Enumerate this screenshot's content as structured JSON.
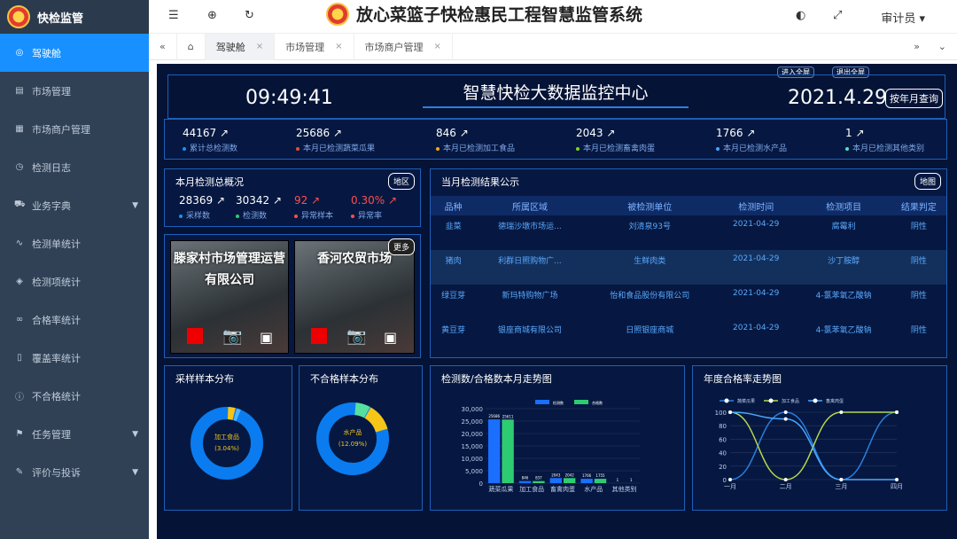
{
  "sidebar": {
    "brand": "快检监管",
    "items": [
      {
        "label": "驾驶舱",
        "icon": "dashboard-icon",
        "active": true
      },
      {
        "label": "市场管理",
        "icon": "document-icon"
      },
      {
        "label": "市场商户管理",
        "icon": "calendar-icon"
      },
      {
        "label": "检测日志",
        "icon": "clock-icon"
      },
      {
        "label": "业务字典",
        "icon": "car-icon",
        "expand": true
      },
      {
        "label": "检测单统计",
        "icon": "pulse-icon"
      },
      {
        "label": "检测项统计",
        "icon": "chat-icon"
      },
      {
        "label": "合格率统计",
        "icon": "infinity-icon"
      },
      {
        "label": "覆盖率统计",
        "icon": "file-icon"
      },
      {
        "label": "不合格统计",
        "icon": "info-icon"
      },
      {
        "label": "任务管理",
        "icon": "flag-icon",
        "expand": true
      },
      {
        "label": "评价与投诉",
        "icon": "edit-icon",
        "expand": true
      }
    ]
  },
  "header": {
    "title": "放心菜篮子快检惠民工程智慧监管系统",
    "user": "审计员"
  },
  "tabs": [
    {
      "label": "驾驶舱",
      "active": true
    },
    {
      "label": "市场管理"
    },
    {
      "label": "市场商户管理"
    }
  ],
  "dashboard": {
    "center_title": "智慧快检大数据监控中心",
    "clock": "09:49:41",
    "date": "2021.4.29",
    "date_button": "按年月查询",
    "fullscreen_in": "进入全屏",
    "fullscreen_out": "退出全屏",
    "stats": [
      {
        "value": "44167",
        "label": "累计总检测数",
        "color": "#1890ff"
      },
      {
        "value": "25686",
        "label": "本月已检测蔬菜瓜果",
        "color": "#e74c3c"
      },
      {
        "value": "846",
        "label": "本月已检测加工食品",
        "color": "#f5a623"
      },
      {
        "value": "2043",
        "label": "本月已检测畜禽肉蛋",
        "color": "#7ed321"
      },
      {
        "value": "1766",
        "label": "本月已检测水产品",
        "color": "#4aa3ff"
      },
      {
        "value": "1",
        "label": "本月已检测其他类别",
        "color": "#50e3c2"
      }
    ],
    "monthly": {
      "title": "本月检测总概况",
      "button": "地区",
      "items": [
        {
          "value": "28369",
          "label": "采样数",
          "vcolor": "#fff",
          "dcolor": "#1890ff"
        },
        {
          "value": "30342",
          "label": "检测数",
          "vcolor": "#fff",
          "dcolor": "#2ecc71"
        },
        {
          "value": "92",
          "label": "异常样本",
          "vcolor": "#ff4d4f",
          "dcolor": "#ff4d4f"
        },
        {
          "value": "0.30%",
          "label": "异常率",
          "vcolor": "#ff4d4f",
          "dcolor": "#ff4d4f"
        }
      ]
    },
    "cameras": {
      "more": "更多",
      "items": [
        "滕家村市场管理运营有限公司",
        "香河农贸市场"
      ]
    },
    "results": {
      "title": "当月检测结果公示",
      "button": "地图",
      "headers": [
        "品种",
        "所属区域",
        "被检测单位",
        "检测时间",
        "检测项目",
        "结果判定"
      ],
      "rows": [
        [
          "韭菜",
          "德瑞沙墩市场运...",
          "刘清泉93号",
          "2021-04-29",
          "腐霉利",
          "阴性"
        ],
        [
          "猪肉",
          "利群日照购物广...",
          "生鲜肉类",
          "2021-04-29",
          "沙丁胺醇",
          "阴性"
        ],
        [
          "绿豆芽",
          "新玛特购物广场",
          "怡和食品股份有限公司",
          "2021-04-29",
          "4-氯苯氧乙酸钠",
          "阴性"
        ],
        [
          "黄豆芽",
          "银座商城有限公司",
          "日照银座商城",
          "2021-04-29",
          "4-氯苯氧乙酸钠",
          "阴性"
        ]
      ]
    },
    "donut1": {
      "title": "采样样本分布",
      "label": "加工食品",
      "pct": "(3.04%)"
    },
    "donut2": {
      "title": "不合格样本分布",
      "label": "水产品",
      "pct": "(12.09%)"
    },
    "bar_title": "检测数/合格数本月走势图",
    "line_title": "年度合格率走势图"
  },
  "chart_data": [
    {
      "type": "bar",
      "categories": [
        "蔬菜瓜果",
        "加工食品",
        "畜禽肉蛋",
        "水产品",
        "其他类别"
      ],
      "series": [
        {
          "name": "检测数",
          "values": [
            25686,
            846,
            2043,
            1766,
            1
          ]
        },
        {
          "name": "合格数",
          "values": [
            25611,
            837,
            2042,
            1755,
            1
          ]
        }
      ],
      "ylim": [
        0,
        30000
      ],
      "yticks": [
        "30,000",
        "25,000",
        "20,000",
        "15,000",
        "10,000",
        "5,000",
        "0"
      ],
      "colors": [
        "#1a6fff",
        "#2ecc71"
      ]
    },
    {
      "type": "line",
      "categories": [
        "一月",
        "二月",
        "三月",
        "四月"
      ],
      "series": [
        {
          "name": "蔬菜瓜果",
          "values": [
            0,
            100,
            0,
            100
          ]
        },
        {
          "name": "加工食品",
          "values": [
            100,
            0,
            100,
            100
          ]
        },
        {
          "name": "畜禽肉蛋",
          "values": [
            100,
            90,
            0,
            0
          ]
        }
      ],
      "ylim": [
        0,
        100
      ],
      "yticks": [
        "100",
        "80",
        "60",
        "40",
        "20",
        "0"
      ],
      "colors": [
        "#2a7fe0",
        "#b6d94c",
        "#4aa8ff"
      ]
    }
  ]
}
